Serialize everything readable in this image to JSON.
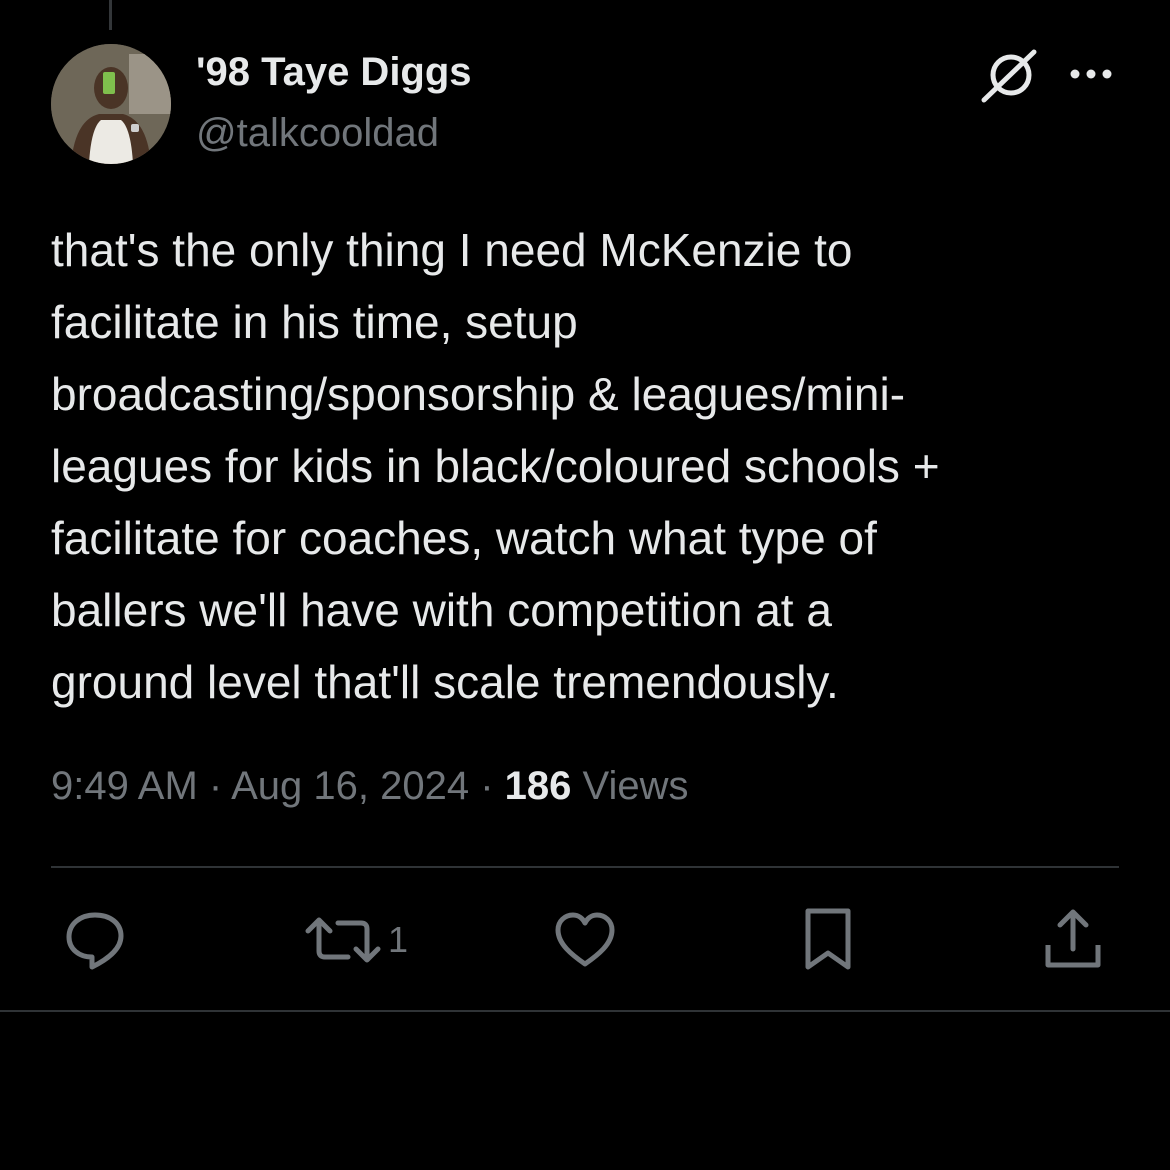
{
  "author": {
    "display_name": "'98 Taye Diggs",
    "handle": "@talkcooldad",
    "avatar_icon": "profile-photo"
  },
  "header_icons": {
    "grok": "grok-icon",
    "more": "more-icon"
  },
  "tweet": {
    "text_lines": [
      "that's the only thing I need McKenzie to",
      "facilitate in his time, setup",
      "broadcasting/sponsorship & leagues/mini-",
      "leagues for kids in black/coloured schools +",
      "facilitate for coaches, watch what type of",
      "ballers we'll have with competition at a",
      "ground level that'll scale tremendously."
    ]
  },
  "meta": {
    "time": "9:49 AM",
    "separator": " · ",
    "date": "Aug 16, 2024",
    "views_count": "186",
    "views_label": " Views"
  },
  "actions": {
    "reply_icon": "reply-icon",
    "repost_icon": "repost-icon",
    "repost_count": "1",
    "like_icon": "heart-icon",
    "bookmark_icon": "bookmark-icon",
    "share_icon": "share-icon"
  },
  "colors": {
    "background": "#000000",
    "primary_text": "#e7e9ea",
    "secondary_text": "#71767b",
    "divider": "#2f3336"
  }
}
